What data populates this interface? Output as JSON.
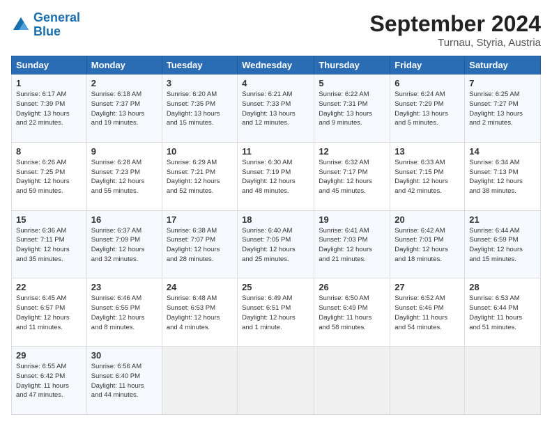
{
  "header": {
    "logo_line1": "General",
    "logo_line2": "Blue",
    "month": "September 2024",
    "location": "Turnau, Styria, Austria"
  },
  "weekdays": [
    "Sunday",
    "Monday",
    "Tuesday",
    "Wednesday",
    "Thursday",
    "Friday",
    "Saturday"
  ],
  "weeks": [
    [
      {
        "day": "1",
        "info": "Sunrise: 6:17 AM\nSunset: 7:39 PM\nDaylight: 13 hours\nand 22 minutes."
      },
      {
        "day": "2",
        "info": "Sunrise: 6:18 AM\nSunset: 7:37 PM\nDaylight: 13 hours\nand 19 minutes."
      },
      {
        "day": "3",
        "info": "Sunrise: 6:20 AM\nSunset: 7:35 PM\nDaylight: 13 hours\nand 15 minutes."
      },
      {
        "day": "4",
        "info": "Sunrise: 6:21 AM\nSunset: 7:33 PM\nDaylight: 13 hours\nand 12 minutes."
      },
      {
        "day": "5",
        "info": "Sunrise: 6:22 AM\nSunset: 7:31 PM\nDaylight: 13 hours\nand 9 minutes."
      },
      {
        "day": "6",
        "info": "Sunrise: 6:24 AM\nSunset: 7:29 PM\nDaylight: 13 hours\nand 5 minutes."
      },
      {
        "day": "7",
        "info": "Sunrise: 6:25 AM\nSunset: 7:27 PM\nDaylight: 13 hours\nand 2 minutes."
      }
    ],
    [
      {
        "day": "8",
        "info": "Sunrise: 6:26 AM\nSunset: 7:25 PM\nDaylight: 12 hours\nand 59 minutes."
      },
      {
        "day": "9",
        "info": "Sunrise: 6:28 AM\nSunset: 7:23 PM\nDaylight: 12 hours\nand 55 minutes."
      },
      {
        "day": "10",
        "info": "Sunrise: 6:29 AM\nSunset: 7:21 PM\nDaylight: 12 hours\nand 52 minutes."
      },
      {
        "day": "11",
        "info": "Sunrise: 6:30 AM\nSunset: 7:19 PM\nDaylight: 12 hours\nand 48 minutes."
      },
      {
        "day": "12",
        "info": "Sunrise: 6:32 AM\nSunset: 7:17 PM\nDaylight: 12 hours\nand 45 minutes."
      },
      {
        "day": "13",
        "info": "Sunrise: 6:33 AM\nSunset: 7:15 PM\nDaylight: 12 hours\nand 42 minutes."
      },
      {
        "day": "14",
        "info": "Sunrise: 6:34 AM\nSunset: 7:13 PM\nDaylight: 12 hours\nand 38 minutes."
      }
    ],
    [
      {
        "day": "15",
        "info": "Sunrise: 6:36 AM\nSunset: 7:11 PM\nDaylight: 12 hours\nand 35 minutes."
      },
      {
        "day": "16",
        "info": "Sunrise: 6:37 AM\nSunset: 7:09 PM\nDaylight: 12 hours\nand 32 minutes."
      },
      {
        "day": "17",
        "info": "Sunrise: 6:38 AM\nSunset: 7:07 PM\nDaylight: 12 hours\nand 28 minutes."
      },
      {
        "day": "18",
        "info": "Sunrise: 6:40 AM\nSunset: 7:05 PM\nDaylight: 12 hours\nand 25 minutes."
      },
      {
        "day": "19",
        "info": "Sunrise: 6:41 AM\nSunset: 7:03 PM\nDaylight: 12 hours\nand 21 minutes."
      },
      {
        "day": "20",
        "info": "Sunrise: 6:42 AM\nSunset: 7:01 PM\nDaylight: 12 hours\nand 18 minutes."
      },
      {
        "day": "21",
        "info": "Sunrise: 6:44 AM\nSunset: 6:59 PM\nDaylight: 12 hours\nand 15 minutes."
      }
    ],
    [
      {
        "day": "22",
        "info": "Sunrise: 6:45 AM\nSunset: 6:57 PM\nDaylight: 12 hours\nand 11 minutes."
      },
      {
        "day": "23",
        "info": "Sunrise: 6:46 AM\nSunset: 6:55 PM\nDaylight: 12 hours\nand 8 minutes."
      },
      {
        "day": "24",
        "info": "Sunrise: 6:48 AM\nSunset: 6:53 PM\nDaylight: 12 hours\nand 4 minutes."
      },
      {
        "day": "25",
        "info": "Sunrise: 6:49 AM\nSunset: 6:51 PM\nDaylight: 12 hours\nand 1 minute."
      },
      {
        "day": "26",
        "info": "Sunrise: 6:50 AM\nSunset: 6:49 PM\nDaylight: 11 hours\nand 58 minutes."
      },
      {
        "day": "27",
        "info": "Sunrise: 6:52 AM\nSunset: 6:46 PM\nDaylight: 11 hours\nand 54 minutes."
      },
      {
        "day": "28",
        "info": "Sunrise: 6:53 AM\nSunset: 6:44 PM\nDaylight: 11 hours\nand 51 minutes."
      }
    ],
    [
      {
        "day": "29",
        "info": "Sunrise: 6:55 AM\nSunset: 6:42 PM\nDaylight: 11 hours\nand 47 minutes."
      },
      {
        "day": "30",
        "info": "Sunrise: 6:56 AM\nSunset: 6:40 PM\nDaylight: 11 hours\nand 44 minutes."
      },
      {
        "day": "",
        "info": ""
      },
      {
        "day": "",
        "info": ""
      },
      {
        "day": "",
        "info": ""
      },
      {
        "day": "",
        "info": ""
      },
      {
        "day": "",
        "info": ""
      }
    ]
  ]
}
